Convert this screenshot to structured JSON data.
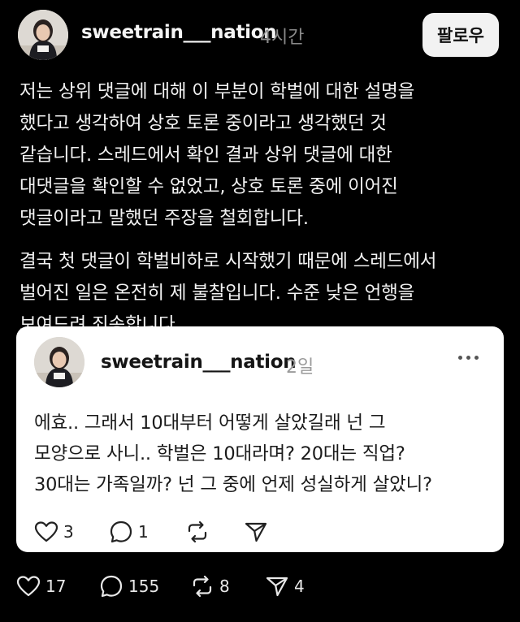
{
  "post": {
    "username": "sweetrain___nation",
    "time": "4시간",
    "follow_label": "팔로우",
    "paragraphs": [
      [
        "저는 상위 댓글에 대해 이 부분이 학벌에 대한 설명을",
        "했다고 생각하여 상호 토론 중이라고 생각했던 것",
        "같습니다. 스레드에서 확인 결과 상위 댓글에 대한",
        "대댓글을 확인할 수 없었고,  상호 토론 중에 이어진",
        "댓글이라고 말했던 주장을 철회합니다."
      ],
      [
        "결국 첫 댓글이 학벌비하로 시작했기 때문에 스레드에서",
        "벌어진 일은 온전히 제 불찰입니다. 수준 낮은 언행을",
        "보여드려 죄송합니다."
      ]
    ],
    "stats": {
      "likes": "17",
      "replies": "155",
      "reposts": "8",
      "shares": "4"
    }
  },
  "quoted": {
    "username": "sweetrain___nation",
    "time": "2일",
    "lines": [
      "에효.. 그래서 10대부터 어떻게 살았길래 넌 그",
      "모양으로 사니.. 학벌은 10대라며? 20대는 직업?",
      "30대는 가족일까? 넌 그 중에 언제 성실하게 살았니?"
    ],
    "stats": {
      "likes": "3",
      "replies": "1"
    }
  },
  "icons": [
    "heart-icon",
    "comment-icon",
    "repost-icon",
    "share-icon",
    "more-icon"
  ],
  "colors": {
    "background": "#000000",
    "card": "#ffffff",
    "muted": "#8a8a8a"
  }
}
